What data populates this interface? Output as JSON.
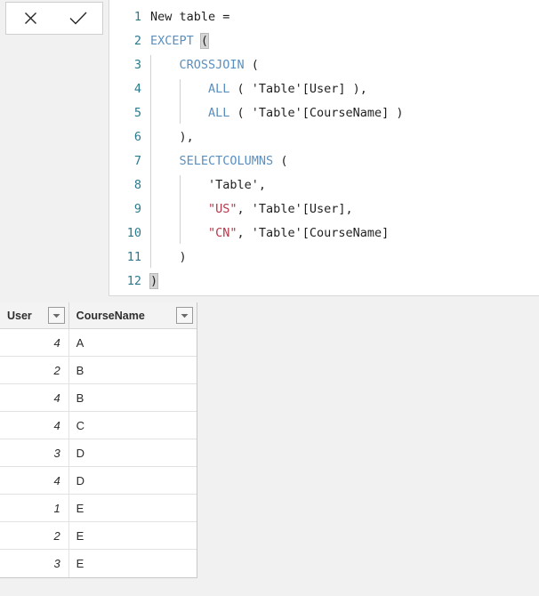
{
  "formula_bar": {
    "cancel_label": "Cancel",
    "commit_label": "Commit",
    "cancel_icon": "close-icon",
    "commit_icon": "check-icon",
    "lines": [
      {
        "number": "1",
        "indent": 0,
        "tokens": [
          {
            "t": "New table = ",
            "c": "plain"
          }
        ]
      },
      {
        "number": "2",
        "indent": 0,
        "tokens": [
          {
            "t": "EXCEPT",
            "c": "kw"
          },
          {
            "t": " ",
            "c": "plain"
          },
          {
            "t": "(",
            "c": "brk"
          }
        ]
      },
      {
        "number": "3",
        "indent": 1,
        "tokens": [
          {
            "t": "    ",
            "c": "plain"
          },
          {
            "t": "CROSSJOIN",
            "c": "kw"
          },
          {
            "t": " (",
            "c": "plain"
          }
        ]
      },
      {
        "number": "4",
        "indent": 2,
        "tokens": [
          {
            "t": "        ",
            "c": "plain"
          },
          {
            "t": "ALL",
            "c": "kw"
          },
          {
            "t": " ( 'Table'[User] ),",
            "c": "plain"
          }
        ]
      },
      {
        "number": "5",
        "indent": 2,
        "tokens": [
          {
            "t": "        ",
            "c": "plain"
          },
          {
            "t": "ALL",
            "c": "kw"
          },
          {
            "t": " ( 'Table'[CourseName] )",
            "c": "plain"
          }
        ]
      },
      {
        "number": "6",
        "indent": 1,
        "tokens": [
          {
            "t": "    ),",
            "c": "plain"
          }
        ]
      },
      {
        "number": "7",
        "indent": 1,
        "tokens": [
          {
            "t": "    ",
            "c": "plain"
          },
          {
            "t": "SELECTCOLUMNS",
            "c": "kw"
          },
          {
            "t": " (",
            "c": "plain"
          }
        ]
      },
      {
        "number": "8",
        "indent": 2,
        "tokens": [
          {
            "t": "        'Table',",
            "c": "plain"
          }
        ]
      },
      {
        "number": "9",
        "indent": 2,
        "tokens": [
          {
            "t": "        ",
            "c": "plain"
          },
          {
            "t": "\"US\"",
            "c": "str"
          },
          {
            "t": ", 'Table'[User],",
            "c": "plain"
          }
        ]
      },
      {
        "number": "10",
        "indent": 2,
        "tokens": [
          {
            "t": "        ",
            "c": "plain"
          },
          {
            "t": "\"CN\"",
            "c": "str"
          },
          {
            "t": ", 'Table'[CourseName]",
            "c": "plain"
          }
        ]
      },
      {
        "number": "11",
        "indent": 1,
        "tokens": [
          {
            "t": "    )",
            "c": "plain"
          }
        ]
      },
      {
        "number": "12",
        "indent": 0,
        "tokens": [
          {
            "t": ")",
            "c": "brk"
          }
        ]
      }
    ]
  },
  "result_grid": {
    "columns": [
      {
        "key": "user",
        "label": "User",
        "filter_icon": "chevron-down-icon"
      },
      {
        "key": "course",
        "label": "CourseName",
        "filter_icon": "chevron-down-icon"
      }
    ],
    "rows": [
      {
        "user": "4",
        "course": "A"
      },
      {
        "user": "2",
        "course": "B"
      },
      {
        "user": "4",
        "course": "B"
      },
      {
        "user": "4",
        "course": "C"
      },
      {
        "user": "3",
        "course": "D"
      },
      {
        "user": "4",
        "course": "D"
      },
      {
        "user": "1",
        "course": "E"
      },
      {
        "user": "2",
        "course": "E"
      },
      {
        "user": "3",
        "course": "E"
      }
    ]
  },
  "colors": {
    "keyword": "#5b8fbe",
    "string": "#b5384a",
    "line_number": "#2b7a8c",
    "editor_bg": "#ffffff",
    "panel_bg": "#f1f1f1",
    "grid_header_bg": "#f3f3f3"
  }
}
